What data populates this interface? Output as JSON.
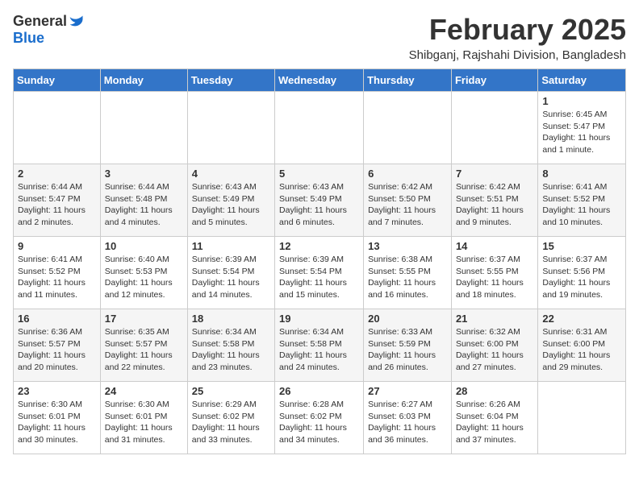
{
  "logo": {
    "general": "General",
    "blue": "Blue"
  },
  "title": "February 2025",
  "subtitle": "Shibganj, Rajshahi Division, Bangladesh",
  "days_of_week": [
    "Sunday",
    "Monday",
    "Tuesday",
    "Wednesday",
    "Thursday",
    "Friday",
    "Saturday"
  ],
  "weeks": [
    [
      {
        "day": "",
        "info": ""
      },
      {
        "day": "",
        "info": ""
      },
      {
        "day": "",
        "info": ""
      },
      {
        "day": "",
        "info": ""
      },
      {
        "day": "",
        "info": ""
      },
      {
        "day": "",
        "info": ""
      },
      {
        "day": "1",
        "info": "Sunrise: 6:45 AM\nSunset: 5:47 PM\nDaylight: 11 hours\nand 1 minute."
      }
    ],
    [
      {
        "day": "2",
        "info": "Sunrise: 6:44 AM\nSunset: 5:47 PM\nDaylight: 11 hours\nand 2 minutes."
      },
      {
        "day": "3",
        "info": "Sunrise: 6:44 AM\nSunset: 5:48 PM\nDaylight: 11 hours\nand 4 minutes."
      },
      {
        "day": "4",
        "info": "Sunrise: 6:43 AM\nSunset: 5:49 PM\nDaylight: 11 hours\nand 5 minutes."
      },
      {
        "day": "5",
        "info": "Sunrise: 6:43 AM\nSunset: 5:49 PM\nDaylight: 11 hours\nand 6 minutes."
      },
      {
        "day": "6",
        "info": "Sunrise: 6:42 AM\nSunset: 5:50 PM\nDaylight: 11 hours\nand 7 minutes."
      },
      {
        "day": "7",
        "info": "Sunrise: 6:42 AM\nSunset: 5:51 PM\nDaylight: 11 hours\nand 9 minutes."
      },
      {
        "day": "8",
        "info": "Sunrise: 6:41 AM\nSunset: 5:52 PM\nDaylight: 11 hours\nand 10 minutes."
      }
    ],
    [
      {
        "day": "9",
        "info": "Sunrise: 6:41 AM\nSunset: 5:52 PM\nDaylight: 11 hours\nand 11 minutes."
      },
      {
        "day": "10",
        "info": "Sunrise: 6:40 AM\nSunset: 5:53 PM\nDaylight: 11 hours\nand 12 minutes."
      },
      {
        "day": "11",
        "info": "Sunrise: 6:39 AM\nSunset: 5:54 PM\nDaylight: 11 hours\nand 14 minutes."
      },
      {
        "day": "12",
        "info": "Sunrise: 6:39 AM\nSunset: 5:54 PM\nDaylight: 11 hours\nand 15 minutes."
      },
      {
        "day": "13",
        "info": "Sunrise: 6:38 AM\nSunset: 5:55 PM\nDaylight: 11 hours\nand 16 minutes."
      },
      {
        "day": "14",
        "info": "Sunrise: 6:37 AM\nSunset: 5:55 PM\nDaylight: 11 hours\nand 18 minutes."
      },
      {
        "day": "15",
        "info": "Sunrise: 6:37 AM\nSunset: 5:56 PM\nDaylight: 11 hours\nand 19 minutes."
      }
    ],
    [
      {
        "day": "16",
        "info": "Sunrise: 6:36 AM\nSunset: 5:57 PM\nDaylight: 11 hours\nand 20 minutes."
      },
      {
        "day": "17",
        "info": "Sunrise: 6:35 AM\nSunset: 5:57 PM\nDaylight: 11 hours\nand 22 minutes."
      },
      {
        "day": "18",
        "info": "Sunrise: 6:34 AM\nSunset: 5:58 PM\nDaylight: 11 hours\nand 23 minutes."
      },
      {
        "day": "19",
        "info": "Sunrise: 6:34 AM\nSunset: 5:58 PM\nDaylight: 11 hours\nand 24 minutes."
      },
      {
        "day": "20",
        "info": "Sunrise: 6:33 AM\nSunset: 5:59 PM\nDaylight: 11 hours\nand 26 minutes."
      },
      {
        "day": "21",
        "info": "Sunrise: 6:32 AM\nSunset: 6:00 PM\nDaylight: 11 hours\nand 27 minutes."
      },
      {
        "day": "22",
        "info": "Sunrise: 6:31 AM\nSunset: 6:00 PM\nDaylight: 11 hours\nand 29 minutes."
      }
    ],
    [
      {
        "day": "23",
        "info": "Sunrise: 6:30 AM\nSunset: 6:01 PM\nDaylight: 11 hours\nand 30 minutes."
      },
      {
        "day": "24",
        "info": "Sunrise: 6:30 AM\nSunset: 6:01 PM\nDaylight: 11 hours\nand 31 minutes."
      },
      {
        "day": "25",
        "info": "Sunrise: 6:29 AM\nSunset: 6:02 PM\nDaylight: 11 hours\nand 33 minutes."
      },
      {
        "day": "26",
        "info": "Sunrise: 6:28 AM\nSunset: 6:02 PM\nDaylight: 11 hours\nand 34 minutes."
      },
      {
        "day": "27",
        "info": "Sunrise: 6:27 AM\nSunset: 6:03 PM\nDaylight: 11 hours\nand 36 minutes."
      },
      {
        "day": "28",
        "info": "Sunrise: 6:26 AM\nSunset: 6:04 PM\nDaylight: 11 hours\nand 37 minutes."
      },
      {
        "day": "",
        "info": ""
      }
    ]
  ]
}
